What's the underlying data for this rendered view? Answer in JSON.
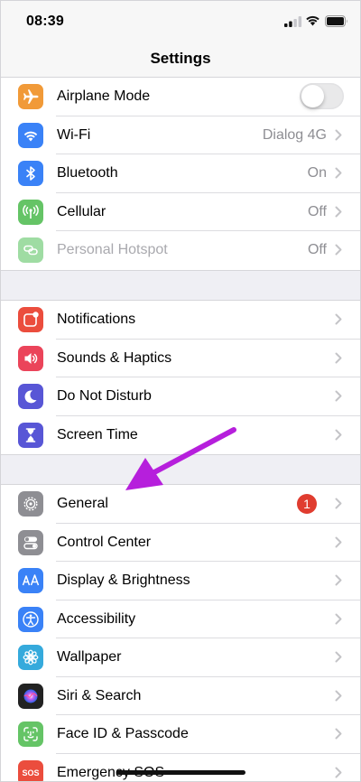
{
  "status_bar": {
    "time": "08:39"
  },
  "nav": {
    "title": "Settings"
  },
  "groups": [
    {
      "rows": [
        {
          "label": "Airplane Mode",
          "icon": "airplane-icon",
          "color": "#f19a38",
          "control": "toggle",
          "toggle_on": false
        },
        {
          "label": "Wi-Fi",
          "icon": "wifi-icon",
          "color": "#3a82f7",
          "value": "Dialog 4G"
        },
        {
          "label": "Bluetooth",
          "icon": "bluetooth-icon",
          "color": "#3a82f7",
          "value": "On"
        },
        {
          "label": "Cellular",
          "icon": "antenna-icon",
          "color": "#65c466",
          "value": "Off"
        },
        {
          "label": "Personal Hotspot",
          "icon": "hotspot-link-icon",
          "color": "#9fdca3",
          "value": "Off",
          "disabled": true
        }
      ]
    },
    {
      "rows": [
        {
          "label": "Notifications",
          "icon": "notifications-icon",
          "color": "#eb4d3d"
        },
        {
          "label": "Sounds & Haptics",
          "icon": "speaker-icon",
          "color": "#eb445a"
        },
        {
          "label": "Do Not Disturb",
          "icon": "moon-icon",
          "color": "#5856d6"
        },
        {
          "label": "Screen Time",
          "icon": "hourglass-icon",
          "color": "#5856d6"
        }
      ]
    },
    {
      "rows": [
        {
          "label": "General",
          "icon": "gear-icon",
          "color": "#8e8e93",
          "badge": "1"
        },
        {
          "label": "Control Center",
          "icon": "toggles-icon",
          "color": "#8e8e93"
        },
        {
          "label": "Display & Brightness",
          "icon": "text-size-icon",
          "color": "#3a82f7"
        },
        {
          "label": "Accessibility",
          "icon": "accessibility-icon",
          "color": "#3a82f7"
        },
        {
          "label": "Wallpaper",
          "icon": "flower-icon",
          "color": "#35aadc"
        },
        {
          "label": "Siri & Search",
          "icon": "siri-icon",
          "color": "#222222"
        },
        {
          "label": "Face ID & Passcode",
          "icon": "face-id-icon",
          "color": "#65c466"
        },
        {
          "label": "Emergency SOS",
          "icon": "sos-icon",
          "color": "#eb4d3d"
        }
      ]
    }
  ],
  "annotation": {
    "color": "#b61fdc"
  }
}
